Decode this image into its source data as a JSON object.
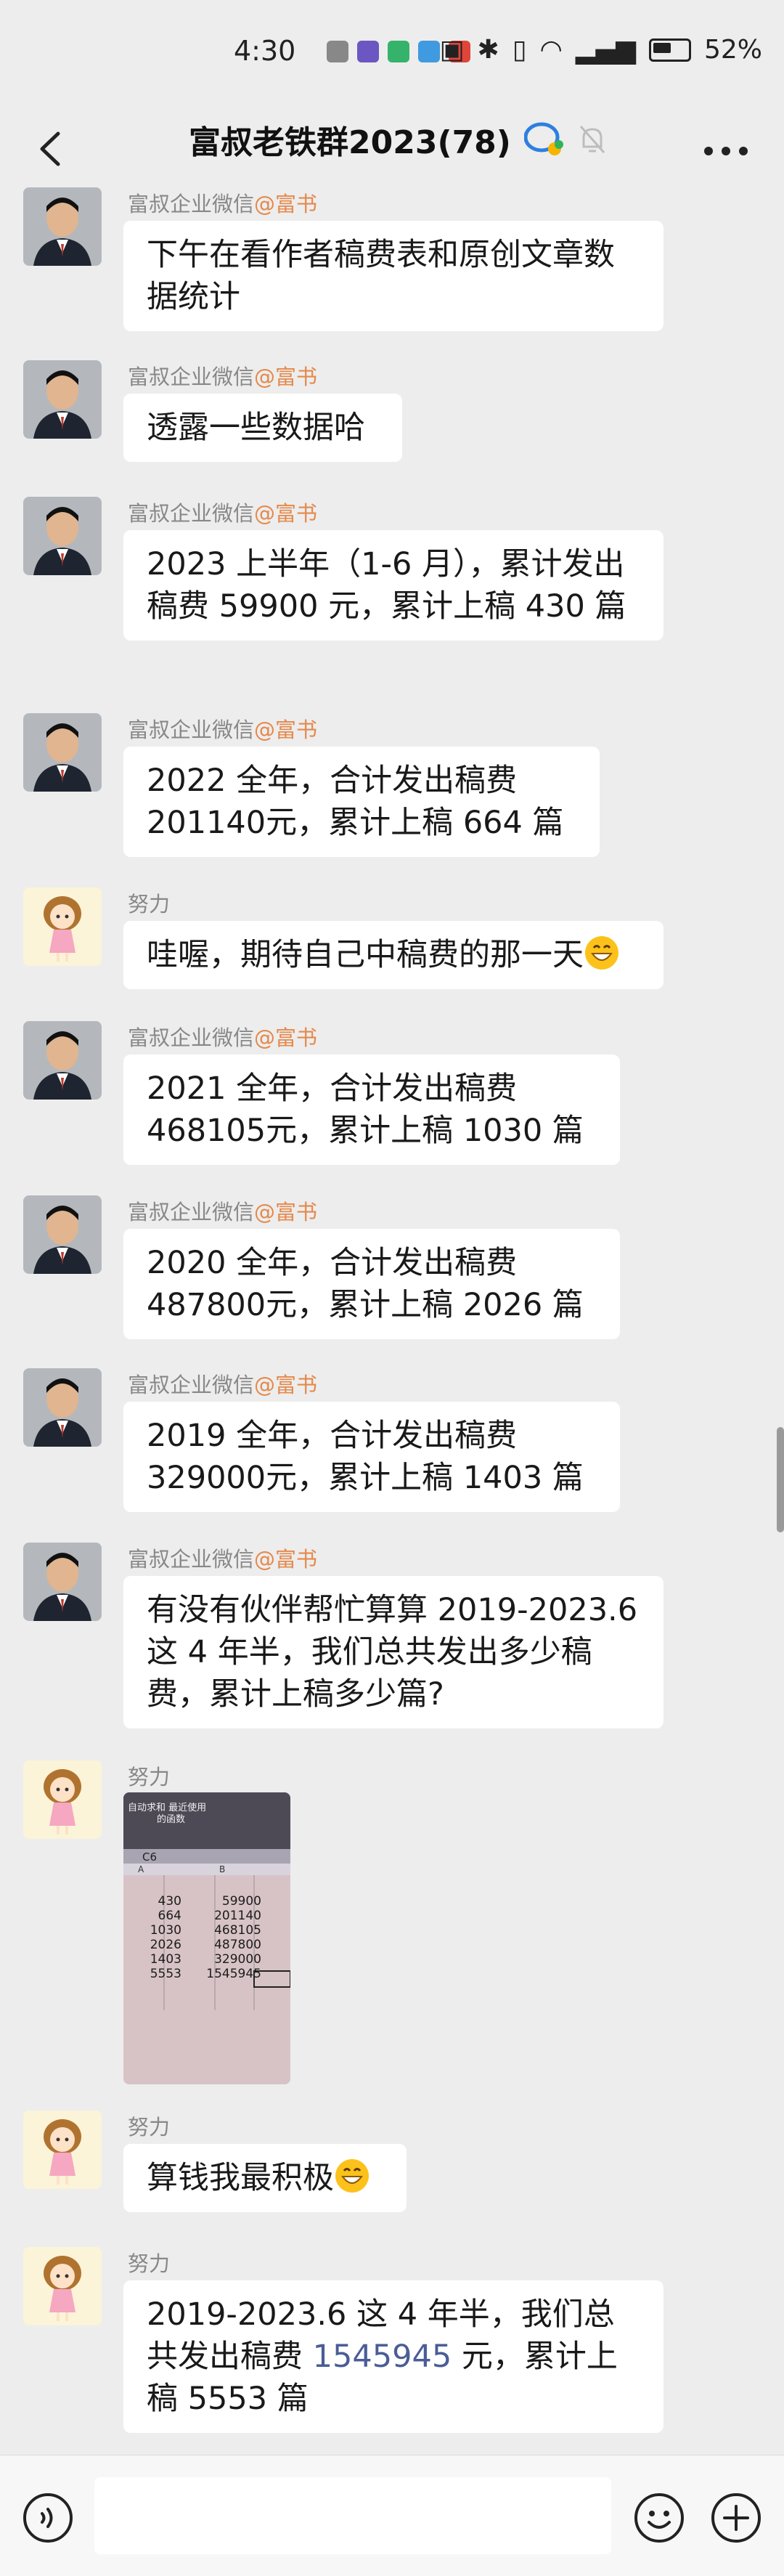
{
  "status_bar": {
    "time": "4:30",
    "battery": "52%"
  },
  "header": {
    "title": "富叔老铁群2023(78)"
  },
  "messages": [
    {
      "sender": "富叔企业微信",
      "mention": "@富书",
      "text": "下午在看作者稿费表和原创文章数据统计"
    },
    {
      "sender": "富叔企业微信",
      "mention": "@富书",
      "text": "透露一些数据哈"
    },
    {
      "sender": "富叔企业微信",
      "mention": "@富书",
      "text": "2023 上半年（1-6 月），累计发出稿费 59900 元，累计上稿 430 篇"
    },
    {
      "sender": "富叔企业微信",
      "mention": "@富书",
      "text": "2022 全年，合计发出稿费 201140元，累计上稿 664 篇"
    },
    {
      "sender": "努力",
      "text": "哇喔，期待自己中稿费的那一天"
    },
    {
      "sender": "富叔企业微信",
      "mention": "@富书",
      "text": "2021 全年，合计发出稿费 468105元，累计上稿 1030 篇"
    },
    {
      "sender": "富叔企业微信",
      "mention": "@富书",
      "text": "2020 全年，合计发出稿费 487800元，累计上稿 2026 篇"
    },
    {
      "sender": "富叔企业微信",
      "mention": "@富书",
      "text": "2019 全年，合计发出稿费 329000元，累计上稿 1403 篇"
    },
    {
      "sender": "富叔企业微信",
      "mention": "@富书",
      "text": "有没有伙伴帮忙算算 2019-2023.6 这 4 年半，我们总共发出多少稿费，累计上稿多少篇?"
    },
    {
      "sender": "努力",
      "photo": {
        "toolbar": [
          "自动求和",
          "最近使用",
          "的函数"
        ],
        "cell_ref": "C6",
        "col_a": "A",
        "col_b": "B",
        "rows": [
          [
            "430",
            "59900"
          ],
          [
            "664",
            "201140"
          ],
          [
            "1030",
            "468105"
          ],
          [
            "2026",
            "487800"
          ],
          [
            "1403",
            "329000"
          ],
          [
            "5553",
            "1545945"
          ]
        ]
      }
    },
    {
      "sender": "努力",
      "text": "算钱我最积极"
    },
    {
      "sender": "努力",
      "text_a": "2019-2023.6 这 4 年半，我们总共发出稿费 ",
      "highlight": "1545945",
      "text_b": " 元，累计上稿 5553 篇"
    }
  ]
}
